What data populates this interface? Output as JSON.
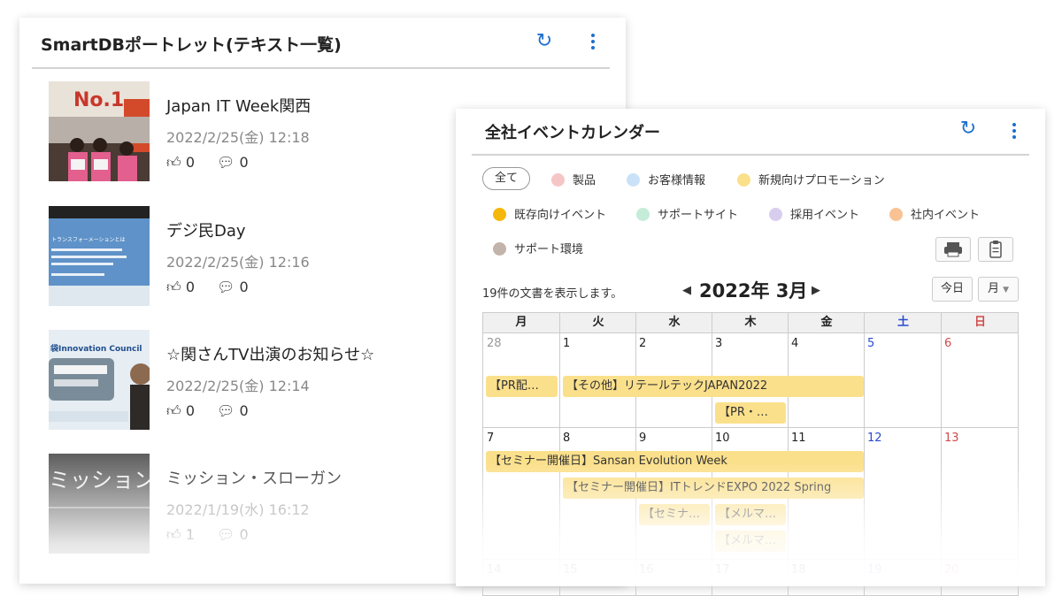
{
  "portlet": {
    "title": "SmartDBポートレット(テキスト一覧)",
    "posts": [
      {
        "title": "Japan IT Week関西",
        "date": "2022/2/25(金) 12:18",
        "likes": "0",
        "comments": "0",
        "thumb_text": "No.1"
      },
      {
        "title": "デジ民Day",
        "date": "2022/2/25(金) 12:16",
        "likes": "0",
        "comments": "0",
        "thumb_text": "トランスフォーメーションとは"
      },
      {
        "title": "☆関さんTV出演のお知らせ☆",
        "date": "2022/2/25(金) 12:14",
        "likes": "0",
        "comments": "0",
        "thumb_text": "袋Innovation Council"
      },
      {
        "title": "ミッション・スローガン",
        "date": "2022/1/19(水) 16:12",
        "likes": "1",
        "comments": "0",
        "thumb_text": "ミッション"
      }
    ]
  },
  "calendar": {
    "title": "全社イベントカレンダー",
    "legend": {
      "all_label": "全て",
      "categories": [
        {
          "label": "製品",
          "color": "#f6c6c6"
        },
        {
          "label": "お客様情報",
          "color": "#c9e2f8"
        },
        {
          "label": "新規向けプロモーション",
          "color": "#fbe08c"
        },
        {
          "label": "既存向けイベント",
          "color": "#f5b80a"
        },
        {
          "label": "サポートサイト",
          "color": "#c4ecd9"
        },
        {
          "label": "採用イベント",
          "color": "#d9cdef"
        },
        {
          "label": "社内イベント",
          "color": "#f9c294"
        },
        {
          "label": "サポート環境",
          "color": "#c2b4ab"
        }
      ]
    },
    "doc_count": "19件の文書を表示します。",
    "month": "2022年 3月",
    "today_label": "今日",
    "view_label": "月",
    "weekdays": [
      "月",
      "火",
      "水",
      "木",
      "金",
      "土",
      "日"
    ],
    "weekday_colors": [
      "#222",
      "#222",
      "#222",
      "#222",
      "#222",
      "#2a4bd0",
      "#d24a4a"
    ],
    "weeks": [
      {
        "days": [
          "28",
          "1",
          "2",
          "3",
          "4",
          "5",
          "6"
        ],
        "events": [
          {
            "label": "【PR配…"
          },
          {
            "label": "【その他】リテールテックJAPAN2022"
          },
          {
            "label": "【PR・…"
          }
        ]
      },
      {
        "days": [
          "7",
          "8",
          "9",
          "10",
          "11",
          "12",
          "13"
        ],
        "events": [
          {
            "label": "【セミナー開催日】Sansan Evolution Week"
          },
          {
            "label": "【セミナー開催日】ITトレンドEXPO 2022 Spring"
          },
          {
            "label": "【セミナ…"
          },
          {
            "label": "【メルマ…"
          },
          {
            "label": "【メルマ…"
          }
        ]
      },
      {
        "days": [
          "14",
          "15",
          "16",
          "17",
          "18",
          "19",
          "20"
        ],
        "events": []
      }
    ]
  }
}
